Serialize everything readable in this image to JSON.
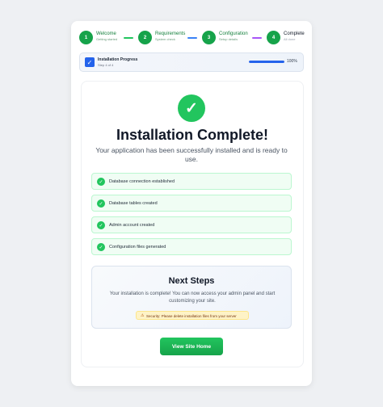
{
  "steps": [
    {
      "number": "1",
      "title": "Welcome",
      "subtitle": "Getting started"
    },
    {
      "number": "2",
      "title": "Requirements",
      "subtitle": "System check"
    },
    {
      "number": "3",
      "title": "Configuration",
      "subtitle": "Setup details"
    },
    {
      "number": "4",
      "title": "Complete",
      "subtitle": "All done"
    }
  ],
  "progress": {
    "title": "Installation Progress",
    "subtitle": "Step 4 of 4",
    "percent_label": "100%",
    "percent": 100
  },
  "main": {
    "title": "Installation Complete!",
    "subtitle": "Your application has been successfully installed and is ready to use."
  },
  "checklist": [
    {
      "label": "Database connection established"
    },
    {
      "label": "Database tables created"
    },
    {
      "label": "Admin account created"
    },
    {
      "label": "Configuration files generated"
    }
  ],
  "next_steps": {
    "title": "Next Steps",
    "body": "Your installation is complete! You can now access your admin panel and start customizing your site.",
    "warning": "Security: Please delete installation files from your server"
  },
  "actions": {
    "home_button": "View Site Home"
  },
  "icons": {
    "check": "check-icon",
    "warning": "warning-icon"
  },
  "colors": {
    "success": "#22c55e",
    "accent": "#2563eb",
    "warning_bg": "#fef3c7"
  }
}
